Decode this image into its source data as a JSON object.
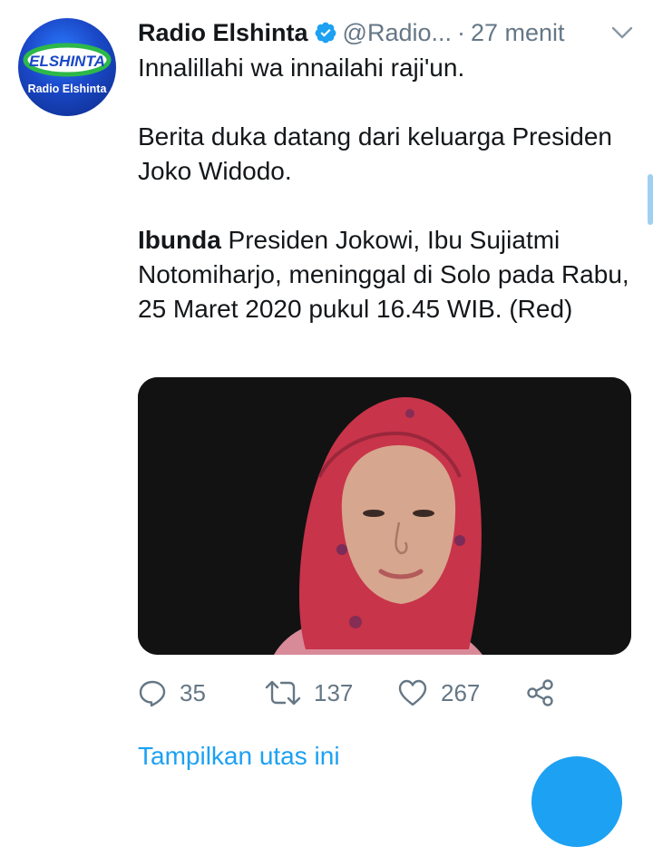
{
  "tweet": {
    "display_name": "Radio Elshinta",
    "handle": "@Radio...",
    "separator": "·",
    "time": "27 menit",
    "avatar": {
      "logo_text": "ELSHINTA",
      "caption": "Radio Elshinta"
    },
    "text": {
      "line1": "Innalillahi wa innailahi raji'un.",
      "para2": "Berita duka datang dari keluarga Presiden Joko Widodo.",
      "para3_bold": "Ibunda",
      "para3_rest": " Presiden Jokowi, Ibu Sujiatmi Notomiharjo, meninggal di Solo pada Rabu, 25 Maret 2020 pukul 16.45 WIB. (Red)"
    },
    "photo_icon": "portrait-photo"
  },
  "actions": {
    "reply_count": "35",
    "retweet_count": "137",
    "like_count": "267"
  },
  "thread_link": "Tampilkan utas ini",
  "colors": {
    "accent": "#1da1f2",
    "muted": "#657786",
    "text": "#14171a"
  }
}
